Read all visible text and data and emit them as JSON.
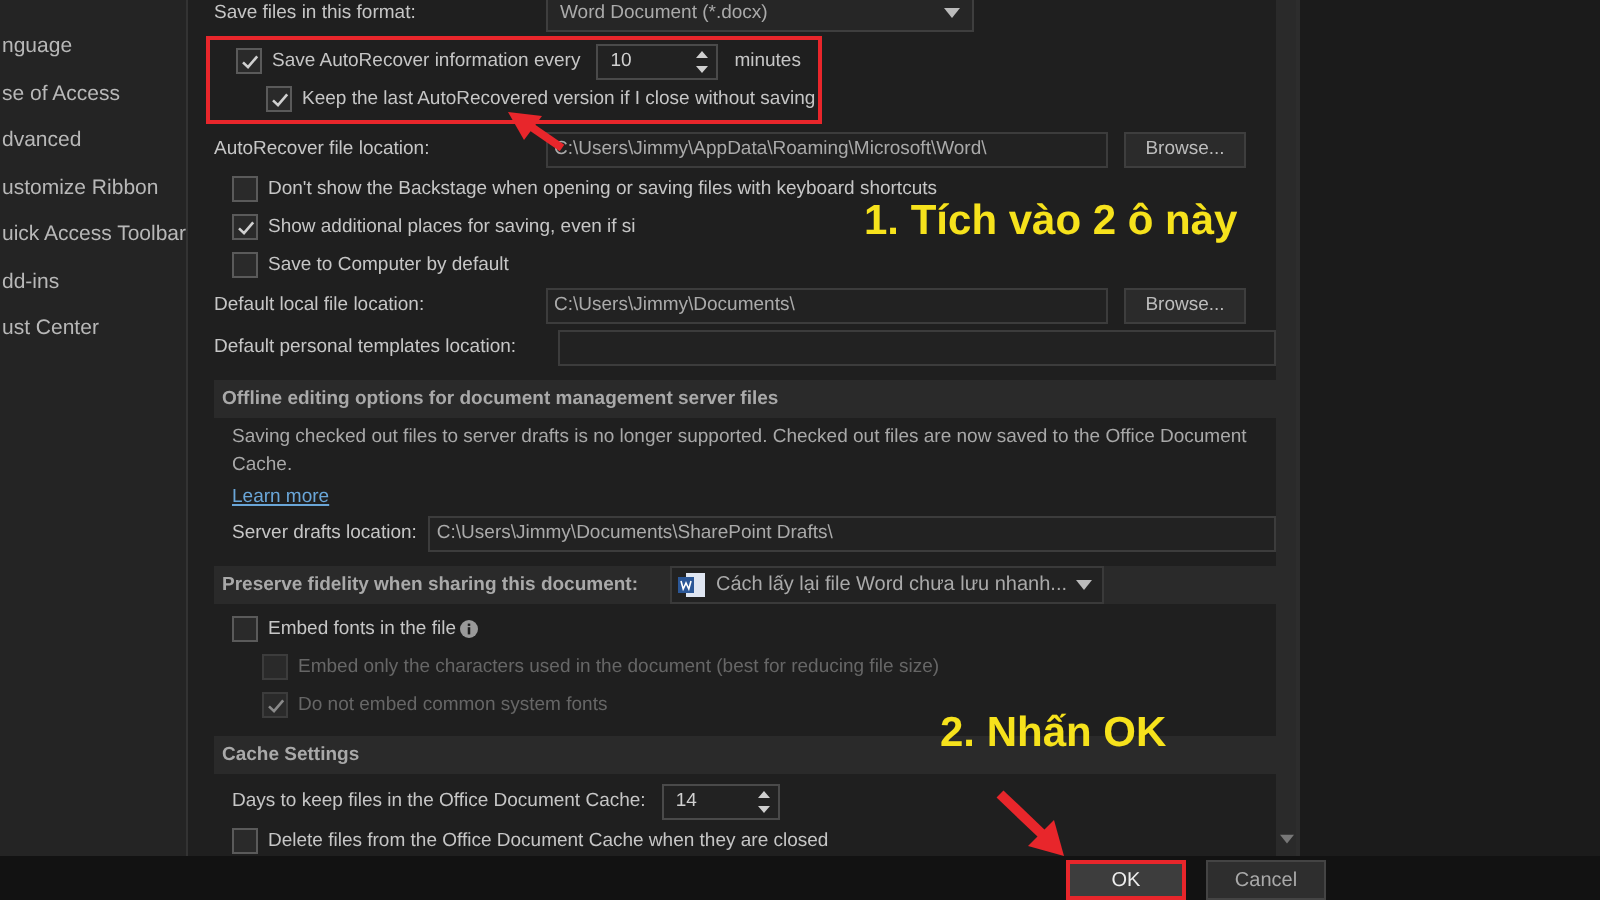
{
  "sidebar": {
    "items": [
      {
        "label": "nguage",
        "selected": false
      },
      {
        "label": "se of Access",
        "selected": false
      },
      {
        "label": "dvanced",
        "selected": false
      },
      {
        "label": "ustomize Ribbon",
        "selected": false
      },
      {
        "label": "uick Access Toolbar",
        "selected": false
      },
      {
        "label": "dd-ins",
        "selected": false
      },
      {
        "label": "ust Center",
        "selected": false
      }
    ]
  },
  "settings": [
    {
      "kind": "dropdown",
      "label": "Save files in this format:",
      "value": "Word Document (*.docx)"
    },
    {
      "kind": "group",
      "highlighted": true,
      "rows": [
        {
          "kind": "spinner_check",
          "label": "Save AutoRecover information every",
          "checked": true,
          "value": "10",
          "unit": "minutes",
          "children": [
            {
              "label": "Keep the last AutoRecovered version if I close without saving",
              "checked": true,
              "disabled": false
            }
          ]
        }
      ]
    },
    {
      "kind": "browse",
      "label": "AutoRecover file location:",
      "value": "C:\\Users\\Jimmy\\AppData\\Roaming\\Microsoft\\Word\\",
      "button": "Browse..."
    },
    {
      "kind": "checkbox",
      "label": "Don't show the Backstage when opening or saving files with keyboard shortcuts",
      "checked": false,
      "disabled": false
    },
    {
      "kind": "checkbox",
      "label": "Show additional places for saving, even if si",
      "checked": true,
      "disabled": false
    },
    {
      "kind": "checkbox",
      "label": "Save to Computer by default",
      "checked": false,
      "disabled": false
    },
    {
      "kind": "browse",
      "label": "Default local file location:",
      "value": "C:\\Users\\Jimmy\\Documents\\",
      "button": "Browse..."
    },
    {
      "kind": "field",
      "label": "Default personal templates location:"
    },
    {
      "kind": "header",
      "label": "Offline editing options for document management server files"
    },
    {
      "kind": "paragraph",
      "text": "Saving checked out files to server drafts is no longer supported. Checked out files are now saved to the Office Document Cache."
    },
    {
      "kind": "link",
      "text": "Learn more"
    },
    {
      "kind": "field",
      "label": "Server drafts location:",
      "value": "C:\\Users\\Jimmy\\Documents\\SharePoint Drafts\\"
    },
    {
      "kind": "header_dropdown",
      "label": "Preserve fidelity when sharing this document:",
      "value": "Cách lấy lại file Word chưa lưu nhanh..."
    },
    {
      "kind": "checkbox",
      "label": "Embed fonts in the file",
      "checked": false,
      "disabled": false,
      "info": true,
      "children": [
        {
          "label": "Embed only the characters used in the document (best for reducing file size)",
          "checked": false,
          "disabled": true
        },
        {
          "label": "Do not embed common system fonts",
          "checked": true,
          "disabled": true
        }
      ]
    },
    {
      "kind": "header",
      "label": "Cache Settings"
    },
    {
      "kind": "spinner",
      "label": "Days to keep files in the Office Document Cache:",
      "value": "14"
    },
    {
      "kind": "checkbox",
      "label": "Delete files from the Office Document Cache when they are closed",
      "checked": false,
      "disabled": false
    }
  ],
  "buttons": [
    {
      "label": "OK",
      "highlighted": true
    },
    {
      "label": "Cancel",
      "highlighted": false
    }
  ],
  "annotations": [
    {
      "text": "1. Tích vào 2 ô này"
    },
    {
      "text": "2. Nhấn OK"
    }
  ]
}
